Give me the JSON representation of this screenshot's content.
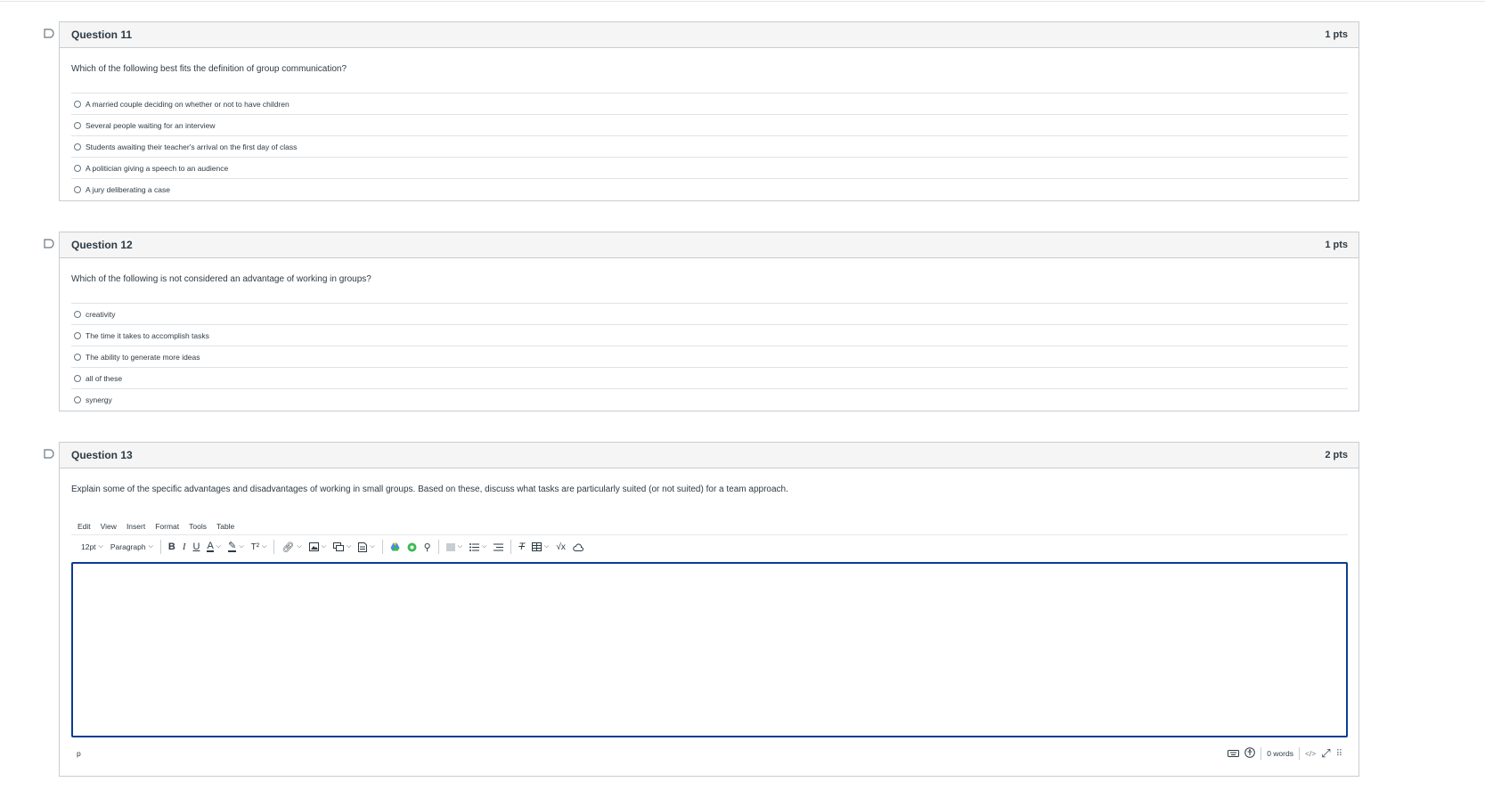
{
  "questions": [
    {
      "title": "Question 11",
      "points": "1 pts",
      "text": "Which of the following best fits the definition of group communication?",
      "answers": [
        "A married couple deciding on whether or not to have children",
        "Several people waiting for an interview",
        "Students awaiting their teacher's arrival on the first day of class",
        "A politician giving a speech to an audience",
        "A jury deliberating a case"
      ]
    },
    {
      "title": "Question 12",
      "points": "1 pts",
      "text": "Which of the following is not considered an advantage of working in groups?",
      "answers": [
        "creativity",
        "The time it takes to accomplish tasks",
        "The ability to generate more ideas",
        "all of these",
        "synergy"
      ]
    },
    {
      "title": "Question 13",
      "points": "2 pts",
      "text": "Explain some of the specific advantages and disadvantages of working in small groups. Based on these, discuss what tasks are particularly suited (or not suited) for a team approach."
    }
  ],
  "editor": {
    "menu": [
      "Edit",
      "View",
      "Insert",
      "Format",
      "Tools",
      "Table"
    ],
    "font_size": "12pt",
    "block_format": "Paragraph",
    "path": "p",
    "word_count": "0 words",
    "html_toggle": "</>"
  },
  "colors": {
    "focus_border": "#0b3d91",
    "header_bg": "#f5f5f5",
    "border": "#c7cdd1"
  }
}
